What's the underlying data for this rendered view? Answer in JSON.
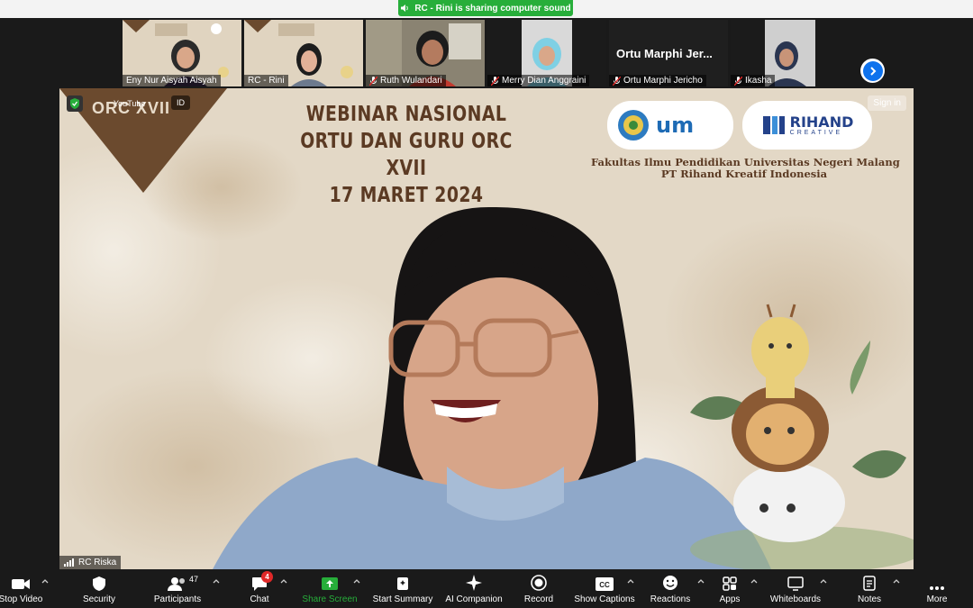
{
  "banner": {
    "text": "RC - Rini is sharing computer sound"
  },
  "gallery": {
    "tiles": [
      {
        "name": "Eny Nur Aisyah Aisyah",
        "muted": false
      },
      {
        "name": "RC - Rini",
        "muted": false
      },
      {
        "name": "Ruth Wulandari",
        "muted": true
      },
      {
        "name": "Merry Dian Anggraini",
        "muted": true
      },
      {
        "name": "Ortu Marphi Jericho",
        "muted": true,
        "display_text": "Ortu  Marphi  Jer..."
      },
      {
        "name": "Ikasha",
        "muted": true
      }
    ]
  },
  "slide": {
    "title_lines": [
      "WEBINAR NASIONAL",
      "ORTU DAN GURU ORC XVII",
      "17 MARET 2024"
    ],
    "orc_text": "ORC XVII",
    "org_lines": [
      "Fakultas Ilmu Pendidikan Universitas Negeri Malang",
      "PT Rihand Kreatif Indonesia"
    ],
    "logo_um_text": "um",
    "logo_rihand_text": "RIHAND",
    "logo_rihand_sub": "CREATIVE",
    "youtube_label": "YouTube",
    "id_button": "ID",
    "sign_in": "Sign in"
  },
  "speaker": {
    "name": "RC Riska"
  },
  "toolbar": {
    "stop_video": "Stop Video",
    "security": "Security",
    "participants": "Participants",
    "participants_count": "47",
    "chat": "Chat",
    "chat_badge": "4",
    "share_screen": "Share Screen",
    "start_summary": "Start Summary",
    "ai_companion": "AI Companion",
    "record": "Record",
    "show_captions": "Show Captions",
    "reactions": "Reactions",
    "apps": "Apps",
    "whiteboards": "Whiteboards",
    "notes": "Notes",
    "more": "More"
  },
  "colors": {
    "share_green": "#27ae3a",
    "zoom_blue": "#0e72ed",
    "slide_brown": "#5b3a23",
    "badge_red": "#e02828"
  }
}
